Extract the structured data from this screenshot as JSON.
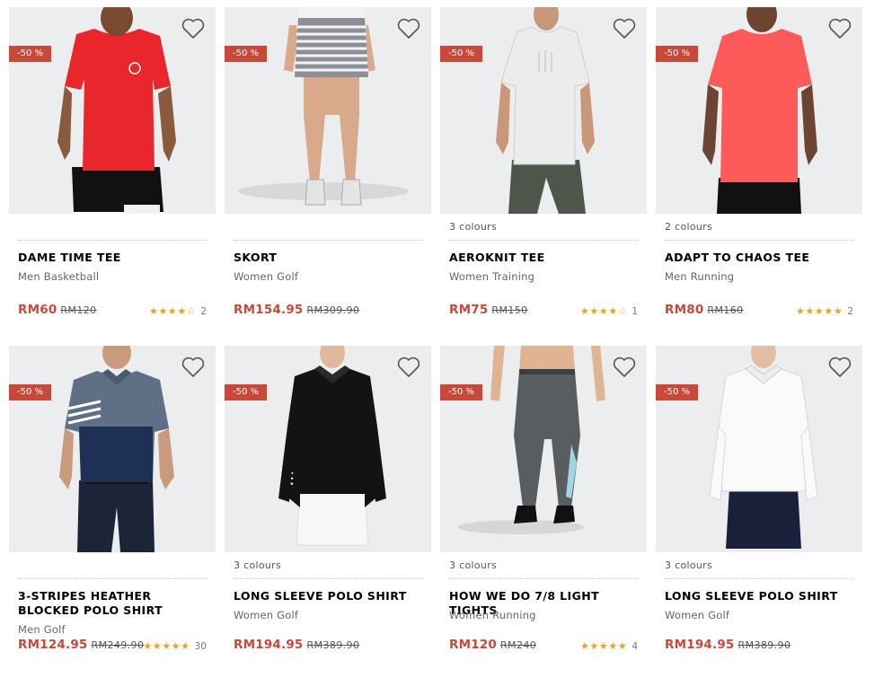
{
  "products": [
    {
      "name": "DAME TIME TEE",
      "category": "Men Basketball",
      "badge": "-50 %",
      "colours": "",
      "price": "RM60",
      "original": "RM120",
      "stars": "★★★★☆",
      "count": "2",
      "rating": 4
    },
    {
      "name": "SKORT",
      "category": "Women Golf",
      "badge": "-50 %",
      "colours": "",
      "price": "RM154.95",
      "original": "RM309.90",
      "stars": "",
      "count": "",
      "rating": 0
    },
    {
      "name": "AEROKNIT TEE",
      "category": "Women Training",
      "badge": "-50 %",
      "colours": "3 colours",
      "price": "RM75",
      "original": "RM150",
      "stars": "★★★★☆",
      "count": "1",
      "rating": 4
    },
    {
      "name": "ADAPT TO CHAOS TEE",
      "category": "Men Running",
      "badge": "-50 %",
      "colours": "2 colours",
      "price": "RM80",
      "original": "RM160",
      "stars": "★★★★★",
      "count": "2",
      "rating": 5
    },
    {
      "name": "3-STRIPES HEATHER BLOCKED POLO SHIRT",
      "category": "Men Golf",
      "badge": "-50 %",
      "colours": "",
      "price": "RM124.95",
      "original": "RM249.90",
      "stars": "★★★★★",
      "count": "30",
      "rating": 5
    },
    {
      "name": "LONG SLEEVE POLO SHIRT",
      "category": "Women Golf",
      "badge": "-50 %",
      "colours": "3 colours",
      "price": "RM194.95",
      "original": "RM389.90",
      "stars": "",
      "count": "",
      "rating": 0
    },
    {
      "name": "HOW WE DO 7/8 LIGHT TIGHTS",
      "category": "Women Running",
      "badge": "-50 %",
      "colours": "3 colours",
      "price": "RM120",
      "original": "RM240",
      "stars": "★★★★★",
      "count": "4",
      "rating": 5
    },
    {
      "name": "LONG SLEEVE POLO SHIRT",
      "category": "Women Golf",
      "badge": "-50 %",
      "colours": "3 colours",
      "price": "RM194.95",
      "original": "RM389.90",
      "stars": "",
      "count": "",
      "rating": 0
    }
  ],
  "icons": {
    "wishlist": "heart-outline-icon"
  },
  "colors": {
    "sale": "#c6493a",
    "badge": "#c6493a",
    "star": "#e8a420",
    "image_bg": "#ebedee"
  }
}
